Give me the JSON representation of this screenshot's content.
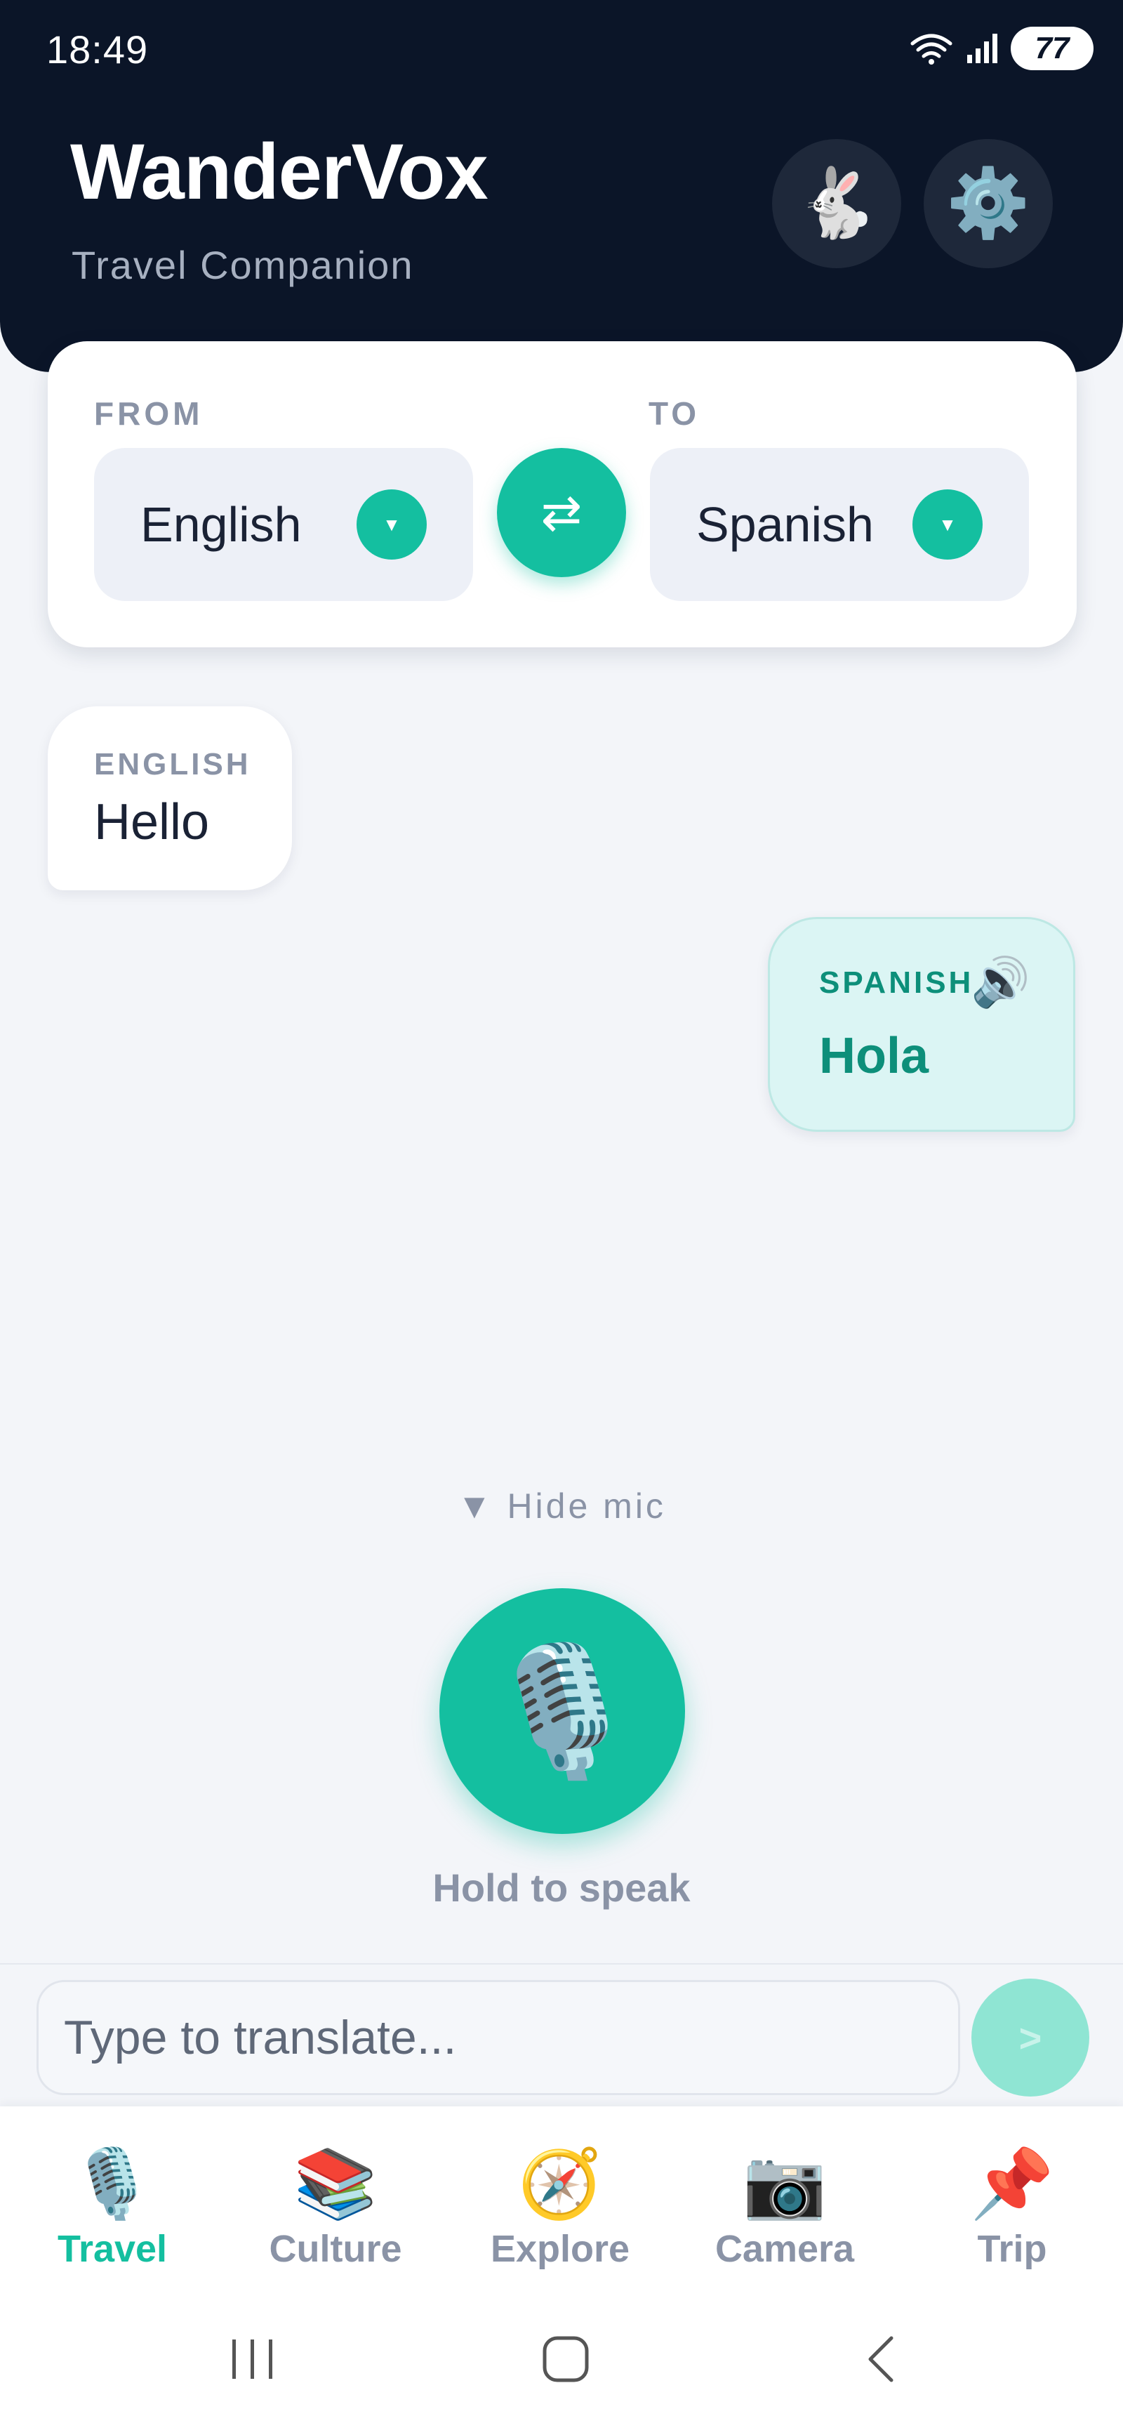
{
  "status_bar": {
    "time": "18:49",
    "battery": "77"
  },
  "header": {
    "title": "WanderVox",
    "subtitle": "Travel Companion"
  },
  "language_card": {
    "from_label": "FROM",
    "to_label": "TO",
    "from_language": "English",
    "to_language": "Spanish",
    "dropdown_glyph": "▼",
    "swap_glyph": "⇄"
  },
  "conversation": {
    "source": {
      "language": "ENGLISH",
      "text": "Hello"
    },
    "translation": {
      "language": "SPANISH",
      "text": "Hola",
      "speaker_glyph": "🔊"
    }
  },
  "mic": {
    "hide_label": "▼ Hide mic",
    "glyph": "🎙️",
    "hold_label": "Hold to speak"
  },
  "input": {
    "placeholder": "Type to translate...",
    "send_glyph": ">"
  },
  "icons": {
    "rabbit": "🐇",
    "settings": "⚙️"
  },
  "bottom_nav": [
    {
      "label": "Travel",
      "icon": "🎙️",
      "active": true
    },
    {
      "label": "Culture",
      "icon": "📚",
      "active": false
    },
    {
      "label": "Explore",
      "icon": "🧭",
      "active": false
    },
    {
      "label": "Camera",
      "icon": "📷",
      "active": false
    },
    {
      "label": "Trip",
      "icon": "📌",
      "active": false
    }
  ],
  "colors": {
    "accent": "#14bfa0",
    "header_bg": "#0b1528",
    "translation_bg": "#dbf5f4",
    "translation_text": "#0d8f7a"
  }
}
